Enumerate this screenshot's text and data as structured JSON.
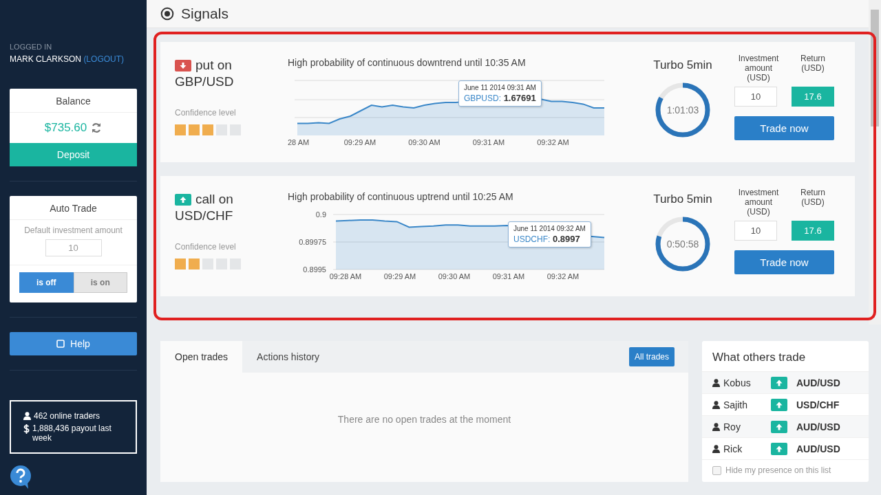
{
  "user": {
    "status": "LOGGED IN",
    "name": "MARK CLARKSON",
    "logout": "(LOGOUT)"
  },
  "balance": {
    "title": "Balance",
    "amount": "$735.60",
    "button": "Deposit"
  },
  "auto_trade": {
    "title": "Auto Trade",
    "label": "Default investment amount",
    "placeholder": "10",
    "options": [
      {
        "label": "is off",
        "selected": true
      },
      {
        "label": "is on",
        "selected": false
      }
    ]
  },
  "help": "Help",
  "stats": [
    "462 online traders",
    "1,888,436 payout last week"
  ],
  "header": {
    "title": "Signals"
  },
  "signals": [
    {
      "kind": "put",
      "action": "put on",
      "pair": "GBP/USD",
      "confidence_label": "Confidence level",
      "stars": 3,
      "forecast": "High probability of continuous downtrend until 10:35 AM",
      "time_labels": [
        "28 AM",
        "09:29 AM",
        "09:30 AM",
        "09:31 AM",
        "09:32 AM"
      ],
      "tooltip": {
        "time": "June 11 2014 09:31 AM",
        "symbol": "GBPUSD:",
        "value": "1.67691"
      },
      "product": "Turbo 5min",
      "countdown": "1:01:03",
      "level": 0.83,
      "investment_label": "Investment amount (USD)",
      "investment": "10",
      "return_label": "Return (USD)",
      "return": "17.6",
      "button": "Trade now"
    },
    {
      "kind": "call",
      "action": "call on",
      "pair": "USD/CHF",
      "confidence_label": "Confidence level",
      "stars": 2,
      "forecast": "High probability of continuous uptrend until 10:25 AM",
      "value_labels": [
        "0.9",
        "0.89975",
        "0.8995"
      ],
      "time_labels": [
        "09:28 AM",
        "09:29 AM",
        "09:30 AM",
        "09:31 AM",
        "09:32 AM"
      ],
      "tooltip": {
        "time": "June 11 2014 09:32 AM",
        "symbol": "USDCHF:",
        "value": "0.8997"
      },
      "product": "Turbo 5min",
      "countdown": "0:50:58",
      "level": 0.8,
      "investment_label": "Investment amount (USD)",
      "investment": "10",
      "return_label": "Return (USD)",
      "return": "17.6",
      "button": "Trade now"
    }
  ],
  "trades": {
    "tabs": [
      {
        "label": "Open trades",
        "selected": true
      },
      {
        "label": "Actions history",
        "selected": false
      }
    ],
    "all_button": "All trades",
    "empty": "There are no open trades at the moment"
  },
  "others": {
    "title": "What others trade",
    "rows": [
      {
        "name": "Kobus",
        "kind": "call",
        "pair": "AUD/USD"
      },
      {
        "name": "Sajith",
        "kind": "call",
        "pair": "USD/CHF"
      },
      {
        "name": "Roy",
        "kind": "call",
        "pair": "AUD/USD"
      },
      {
        "name": "Rick",
        "kind": "call",
        "pair": "AUD/USD"
      }
    ],
    "hide_label": "Hide my presence on this list",
    "hide_checked": false
  }
}
